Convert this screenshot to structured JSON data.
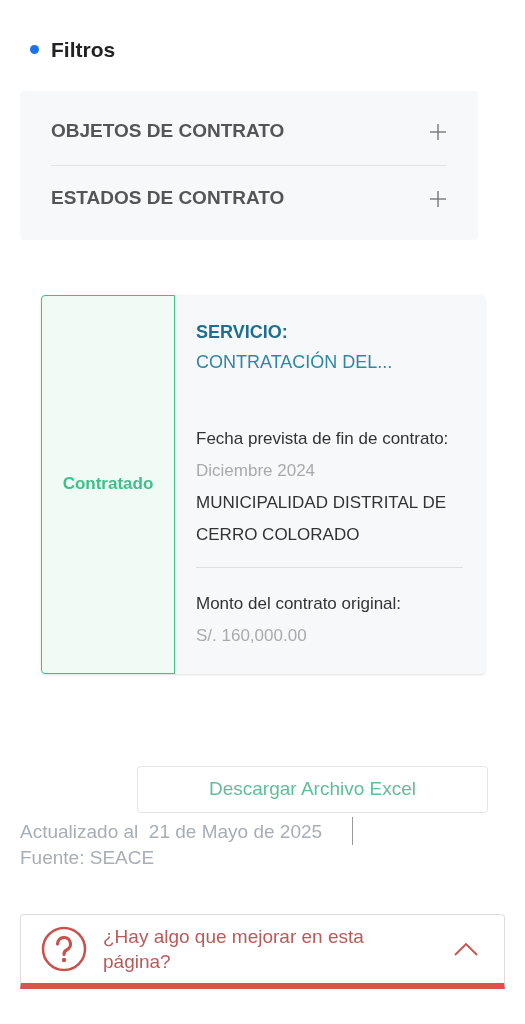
{
  "filters": {
    "title": "Filtros",
    "sections": [
      {
        "label": "OBJETOS DE CONTRATO",
        "expanded": false
      },
      {
        "label": "ESTADOS DE CONTRATO",
        "expanded": false
      }
    ]
  },
  "contracts": [
    {
      "status": "Contratado",
      "color": "#3fbf8a",
      "type": "SERVICIO:",
      "title": "CONTRATACIÓN DEL...",
      "date_label": "Fecha prevista de fin de contrato:",
      "date_value": "Diciembre 2024",
      "entity": "MUNICIPALIDAD DISTRITAL DE CERRO COLORADO",
      "amount_label": "Monto del contrato original:",
      "amount_value": "S/. 160,000.00"
    }
  ],
  "download_button": "Descargar Archivo Excel",
  "updated": {
    "text": "Actualizado al  21 de Mayo de 2025",
    "source": "Fuente: SEACE"
  },
  "feedback": {
    "question": "¿Hay algo que mejorar en esta página?",
    "expanded": false
  }
}
